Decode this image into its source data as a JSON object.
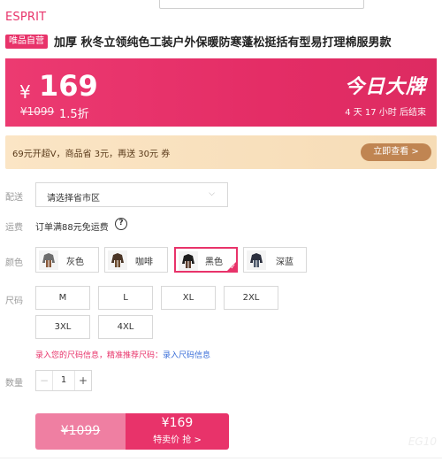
{
  "header": {
    "brand": "ESPRIT",
    "badge": "唯品自营",
    "title": "加厚 秋冬立领纯色工装户外保暖防寒蓬松挺括有型易打理棉服男款"
  },
  "price_banner": {
    "currency": "¥",
    "price": "169",
    "original_price": "¥1099",
    "discount": "1.5折",
    "event_title": "今日大牌",
    "countdown": "4 天 17 小时 后结束"
  },
  "promo": {
    "text": "69元开超V，商品省 3元，再送 30元 券",
    "button": "立即查看 >"
  },
  "delivery": {
    "label": "配送",
    "placeholder": "请选择省市区",
    "chevron": "⌵"
  },
  "shipping": {
    "label": "运费",
    "text": "订单满88元免运费",
    "help": "?"
  },
  "colors": {
    "label": "颜色",
    "options": [
      {
        "name": "灰色",
        "coat": "#6d6d6d",
        "pants": "#8a5a3a"
      },
      {
        "name": "咖啡",
        "coat": "#4a3526",
        "pants": "#6b4a2d"
      },
      {
        "name": "黑色",
        "coat": "#1e1e1e",
        "pants": "#5a3b2a"
      },
      {
        "name": "深蓝",
        "coat": "#2b2f3d",
        "pants": "#4a5668"
      }
    ],
    "selected": "黑色"
  },
  "sizes": {
    "label": "尺码",
    "options": [
      "M",
      "L",
      "XL",
      "2XL",
      "3XL",
      "4XL"
    ],
    "hint_prefix": "录入您的尺码信息，精准推荐尺码：",
    "hint_link": "录入尺码信息"
  },
  "quantity": {
    "label": "数量",
    "minus": "−",
    "value": "1",
    "plus": "+"
  },
  "buy": {
    "original": "¥1099",
    "price": "¥169",
    "action": "特卖价 抢 >"
  },
  "watermark": "EG10",
  "theme": {
    "accent": "#e8336a",
    "promo_bg": "#f9e1bf",
    "promo_btn": "#c08552"
  }
}
